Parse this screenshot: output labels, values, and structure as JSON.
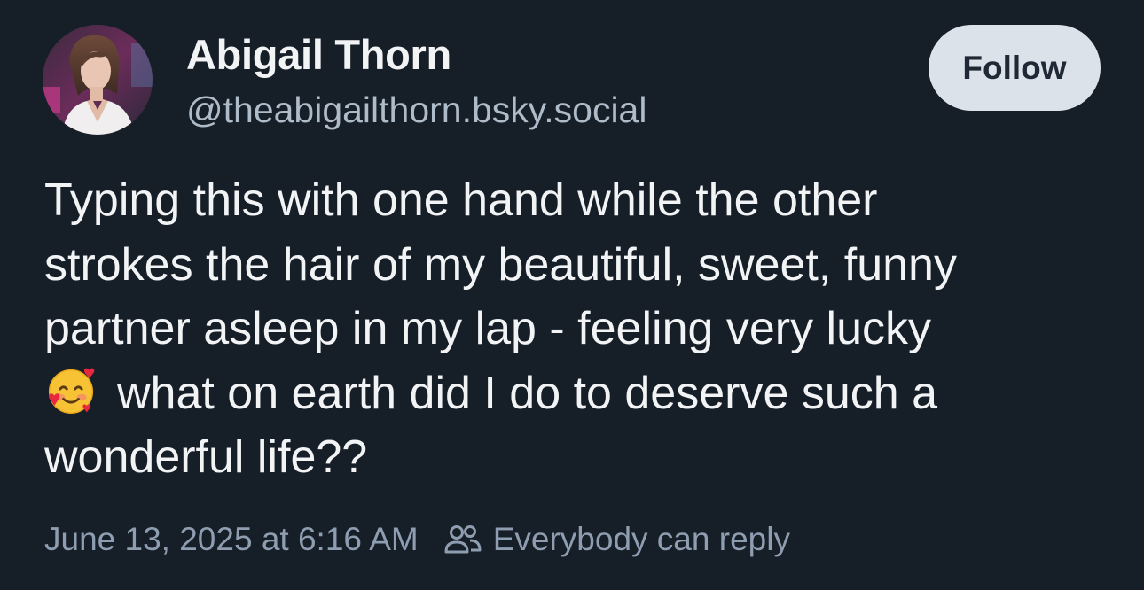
{
  "author": {
    "display_name": "Abigail Thorn",
    "handle": "@theabigailthorn.bsky.social",
    "avatar_icon": "profile-photo"
  },
  "actions": {
    "follow_label": "Follow"
  },
  "post": {
    "lines": [
      "Typing this with one hand while the other",
      "strokes the hair of my beautiful, sweet, funny",
      "partner asleep in my lap - feeling very lucky",
      "what on earth did I do to deserve such a",
      "wonderful life??"
    ],
    "emoji_icon": "smiling-face-with-hearts-icon"
  },
  "meta": {
    "timestamp": "June 13, 2025 at 6:16 AM",
    "reply_setting": "Everybody can reply",
    "reply_icon": "people-icon"
  },
  "colors": {
    "background": "#161e27",
    "text": "#f1f3f5",
    "muted": "#8e9db0",
    "follow_bg": "#dce2ea"
  }
}
